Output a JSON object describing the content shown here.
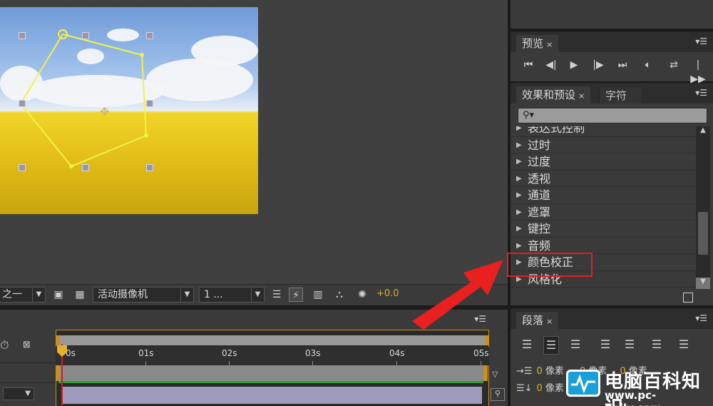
{
  "viewer": {
    "toolbar": {
      "resolution_value": "之一",
      "camera_value": "活动摄像机",
      "views_value": "1 ...",
      "exposure": "+0.0"
    }
  },
  "preview_panel": {
    "tab_label": "预览",
    "close": "×",
    "controls": [
      "first-frame",
      "previous-frame",
      "play",
      "next-frame",
      "last-frame",
      "audio",
      "loop",
      "ram-preview"
    ]
  },
  "effects_panel": {
    "tabs": [
      {
        "label": "效果和预设",
        "active": true
      },
      {
        "label": "字符",
        "active": false
      }
    ],
    "close": "×",
    "search_placeholder": "",
    "items": [
      "表达式控制",
      "过时",
      "过度",
      "透视",
      "通道",
      "遮罩",
      "键控",
      "音频",
      "颜色校正",
      "风格化"
    ],
    "highlighted_item": "颜色校正"
  },
  "timeline": {
    "ruler": [
      "0s",
      "01s",
      "02s",
      "03s",
      "04s",
      "05s"
    ]
  },
  "paragraph_panel": {
    "tab_label": "段落",
    "close": "×",
    "indent_rows": [
      {
        "value": "0",
        "unit": "像素",
        "value2": "0",
        "unit2": "像素",
        "value3": "0",
        "unit3": "像素"
      },
      {
        "value": "0",
        "unit": "像素"
      }
    ]
  },
  "watermark": {
    "title": "电脑百科知识",
    "url": "www.pc-daily.com"
  },
  "colors": {
    "accent_orange": "#e0b030",
    "highlight_red": "#e02020",
    "mask_yellow": "#f2f24a"
  }
}
